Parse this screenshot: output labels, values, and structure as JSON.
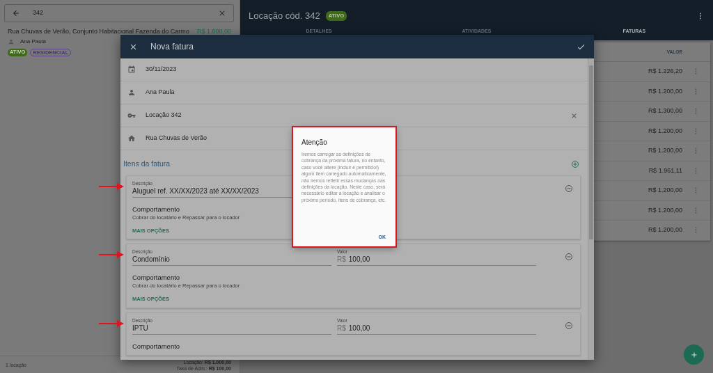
{
  "search": {
    "value": "342"
  },
  "results": [
    {
      "address": "Rua Chuvas de Verão, Conjunto Habitacional Fazenda do Carmo",
      "price": "R$ 1.000,00",
      "tenant": "Ana Paula",
      "tags": [
        {
          "label": "ATIVO",
          "kind": "status"
        },
        {
          "label": "RESIDENCIAL",
          "kind": "type"
        }
      ]
    }
  ],
  "left_footer": {
    "count": "1 locação",
    "lines": [
      "Locação: **R$ 1.000,00**",
      "Taxa de Adm.: **R$ 100,00**"
    ]
  },
  "rental": {
    "title": "Locação cód. 342",
    "badge": "ATIVO",
    "tabs": [
      {
        "label": "DETALHES",
        "selected": false
      },
      {
        "label": "ATIVIDADES",
        "selected": false
      },
      {
        "label": "FATURAS",
        "selected": true
      }
    ],
    "table": {
      "columns": [
        "VALOR"
      ],
      "rows": [
        {
          "value": "R$ 1.226,20"
        },
        {
          "value": "R$ 1.200,00"
        },
        {
          "value": "R$ 1.300,00"
        },
        {
          "value": "R$ 1.200,00"
        },
        {
          "value": "R$ 1.200,00"
        },
        {
          "value": "R$ 1.961,11"
        },
        {
          "value": "R$ 1.200,00"
        },
        {
          "value": "R$ 1.200,00"
        },
        {
          "value": "R$ 1.200,00"
        }
      ]
    }
  },
  "invoice_dialog": {
    "title": "Nova fatura",
    "fields": [
      {
        "kind": "date",
        "value": "30/11/2023",
        "clearable": false
      },
      {
        "kind": "person",
        "value": "Ana Paula",
        "clearable": false
      },
      {
        "kind": "key",
        "value": "Locação 342",
        "clearable": true
      },
      {
        "kind": "home",
        "value": "Rua Chuvas de Verão",
        "clearable": false
      }
    ],
    "items_title": "Itens da fatura",
    "items": [
      {
        "highlighted": true,
        "description_label": "Descrição",
        "description": "Aluguel ref. XX/XX/2023 até XX/XX/2023",
        "behavior_label": "Comportamento",
        "behavior": "Cobrar do locatário e Repassar para o locador",
        "more_options": "MAIS OPÇÕES"
      },
      {
        "highlighted": true,
        "description_label": "Descrição",
        "description": "Condomínio",
        "value_label": "Valor",
        "currency": "R$",
        "value": "100,00",
        "behavior_label": "Comportamento",
        "behavior": "Cobrar do locatário e Repassar para o locador",
        "more_options": "MAIS OPÇÕES"
      },
      {
        "highlighted": true,
        "description_label": "Descrição",
        "description": "IPTU",
        "value_label": "Valor",
        "currency": "R$",
        "value": "100,00",
        "behavior_label": "Comportamento"
      }
    ]
  },
  "alert": {
    "highlighted": true,
    "title": "Atenção",
    "message": "Iremos carregar as definições de cobrança da próxima fatura, no entanto, caso você altere (incluir é permitido!) algum item carregado automaticamente, não iremos refletir essas mudanças nas definições da locação. Neste caso, será necessário editar a locação e analisar o próximo período, itens de cobrança, etc.",
    "button": "OK"
  }
}
